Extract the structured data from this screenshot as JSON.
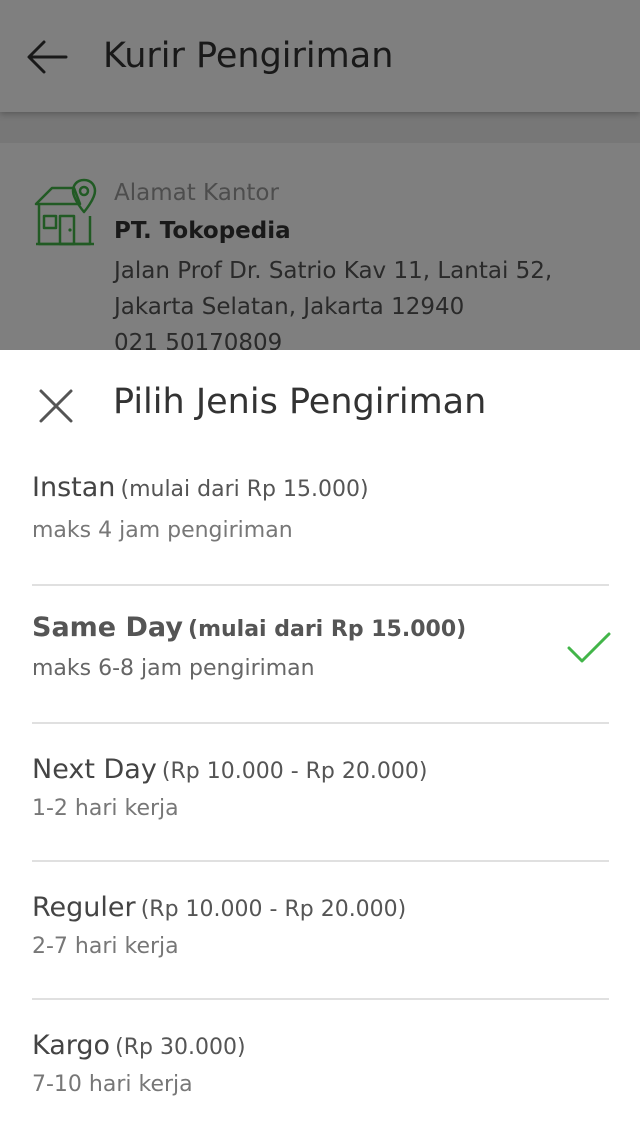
{
  "appbar": {
    "title": "Kurir Pengiriman",
    "back_icon": "arrow-left-icon"
  },
  "address": {
    "icon": "office-location-icon",
    "label": "Alamat Kantor",
    "name": "PT. Tokopedia",
    "line1": "Jalan Prof Dr. Satrio Kav 11, Lantai 52,",
    "line2": "Jakarta Selatan, Jakarta 12940",
    "phone": "021 50170809"
  },
  "sheet": {
    "close_icon": "close-icon",
    "title": "Pilih Jenis Pengiriman",
    "options": [
      {
        "name": "Instan",
        "price": "(mulai dari Rp 15.000)",
        "desc": "maks 4 jam pengiriman",
        "selected": false
      },
      {
        "name": "Same Day",
        "price": "(mulai dari Rp 15.000)",
        "desc": "maks 6-8 jam pengiriman",
        "selected": true
      },
      {
        "name": "Next Day",
        "price": "(Rp 10.000 - Rp 20.000)",
        "desc": "1-2 hari kerja",
        "selected": false
      },
      {
        "name": "Reguler",
        "price": "(Rp 10.000 - Rp 20.000)",
        "desc": "2-7 hari kerja",
        "selected": false
      },
      {
        "name": "Kargo",
        "price": "(Rp 30.000)",
        "desc": "7-10 hari kerja",
        "selected": false
      }
    ],
    "check_icon": "checkmark-icon"
  },
  "colors": {
    "accent": "#42b549",
    "scrim": "#000000"
  }
}
